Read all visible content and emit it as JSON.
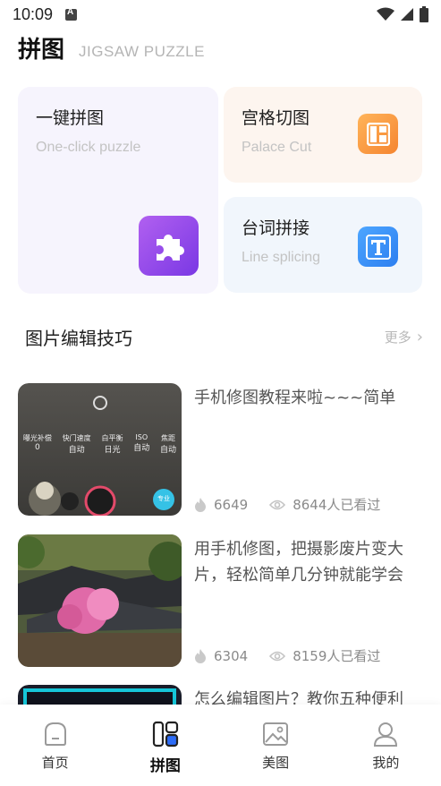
{
  "status_bar": {
    "time": "10:09"
  },
  "header": {
    "title": "拼图",
    "subtitle": "JIGSAW PUZZLE"
  },
  "tools": [
    {
      "title": "一键拼图",
      "subtitle": "One-click puzzle",
      "icon": "puzzle-icon",
      "bg": "#f6f4fd"
    },
    {
      "title": "宫格切图",
      "subtitle": "Palace Cut",
      "icon": "grid-layout-icon",
      "bg": "#fdf5ef"
    },
    {
      "title": "台词拼接",
      "subtitle": "Line splicing",
      "icon": "text-t-icon",
      "bg": "#f1f6fc"
    }
  ],
  "section": {
    "title": "图片编辑技巧",
    "more": "更多"
  },
  "articles": [
    {
      "title": "手机修图教程来啦~~~简单",
      "likes": "6649",
      "views": "8644人已看过",
      "thumb": "camera-settings-screenshot"
    },
    {
      "title": "用手机修图，把摄影废片变大片，轻松简单几分钟就能学会",
      "likes": "6304",
      "views": "8159人已看过",
      "thumb": "temple-blossom-photo"
    },
    {
      "title": "怎么编辑图片？教你五种便利",
      "likes": "",
      "views": "",
      "thumb": "dark-screen-photo"
    }
  ],
  "camera_overlay": {
    "labels": [
      {
        "name": "曝光补偿",
        "value": "0"
      },
      {
        "name": "快门速度",
        "value": "自动"
      },
      {
        "name": "白平衡",
        "value": "日光"
      },
      {
        "name": "ISO",
        "value": "自动"
      },
      {
        "name": "焦距",
        "value": "自动"
      }
    ],
    "pro_button": "专业"
  },
  "tab_bar": {
    "active": 1,
    "tabs": [
      {
        "label": "首页",
        "icon": "home-icon"
      },
      {
        "label": "拼图",
        "icon": "puzzle-layout-icon"
      },
      {
        "label": "美图",
        "icon": "image-icon"
      },
      {
        "label": "我的",
        "icon": "person-icon"
      }
    ]
  },
  "colors": {
    "accent_blue": "#2d6cf6",
    "puzzle_purple": "#8b44ea",
    "palace_orange": "#f58c36",
    "line_blue": "#3a8ff5"
  }
}
